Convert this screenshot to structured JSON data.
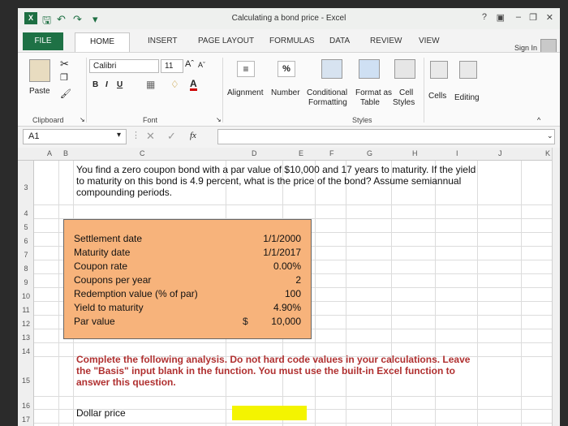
{
  "window": {
    "title": "Calculating a bond price - Excel",
    "app_icon_label": "X",
    "help": "?"
  },
  "tabs": [
    "FILE",
    "HOME",
    "INSERT",
    "PAGE LAYOUT",
    "FORMULAS",
    "DATA",
    "REVIEW",
    "VIEW"
  ],
  "signin": "Sign In",
  "ribbon": {
    "paste": "Paste",
    "clipboard": "Clipboard",
    "font_name": "Calibri",
    "font_size": "11",
    "bold": "B",
    "italic": "I",
    "underline": "U",
    "font_group": "Font",
    "alignment": "Alignment",
    "number": "Number",
    "percent": "%",
    "conditional": "Conditional",
    "formatting": "Formatting",
    "format_as": "Format as",
    "table": "Table",
    "cell": "Cell",
    "styles_small": "Styles",
    "styles_group": "Styles",
    "cells": "Cells",
    "editing": "Editing"
  },
  "formula_bar": {
    "name_box": "A1",
    "fx": "fx"
  },
  "columns": [
    "A",
    "B",
    "C",
    "D",
    "E",
    "F",
    "G",
    "H",
    "I",
    "J",
    "K"
  ],
  "rows": [
    "3",
    "4",
    "5",
    "6",
    "7",
    "8",
    "9",
    "10",
    "11",
    "12",
    "13",
    "14",
    "15",
    "16",
    "17"
  ],
  "problem": {
    "line1": "You find a zero coupon bond with a par value of $10,000 and 17 years to maturity. If the yield",
    "line2": "to maturity on this bond is 4.9 percent, what is the price of the bond? Assume semiannual",
    "line3": "compounding periods."
  },
  "inputs": [
    {
      "label": "Settlement date",
      "value": "1/1/2000"
    },
    {
      "label": "Maturity date",
      "value": "1/1/2017"
    },
    {
      "label": "Coupon rate",
      "value": "0.00%"
    },
    {
      "label": "Coupons per year",
      "value": "2"
    },
    {
      "label": "Redemption value (% of par)",
      "value": "100"
    },
    {
      "label": "Yield to maturity",
      "value": "4.90%"
    },
    {
      "label": "Par value",
      "value": "10,000"
    }
  ],
  "par_currency": "$",
  "instruction": {
    "line1": "Complete the following analysis. Do not hard code values in your calculations. Leave",
    "line2": "the \"Basis\" input blank in the function. You must use the built-in Excel function to",
    "line3": "answer this question."
  },
  "answer": {
    "label": "Dollar price",
    "value": ""
  },
  "colors": {
    "accent": "#1e7145",
    "input_box": "#f7b37b",
    "answer_fill": "#f4f400"
  }
}
